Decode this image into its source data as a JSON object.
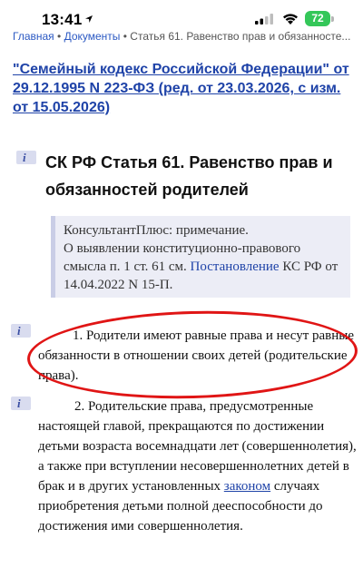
{
  "status_bar": {
    "time": "13:41",
    "battery": "72"
  },
  "breadcrumb": {
    "home": "Главная",
    "sep1": " • ",
    "documents": "Документы",
    "sep2": " • ",
    "current": "Статья 61. Равенство прав и обязанносте..."
  },
  "document": {
    "title": "\"Семейный кодекс Российской Федерации\" от 29.12.1995 N 223-ФЗ (ред. от 23.03.2026, с изм. от 15.05.2026)"
  },
  "info_marker_glyph": "i",
  "article": {
    "heading": "СК РФ Статья 61. Равенство прав и обязанностей родителей"
  },
  "note": {
    "line1": "КонсультантПлюс: примечание.",
    "text_before_link": "О выявлении конституционно-правового смысла п. 1 ст. 61 см. ",
    "link": "Постановление",
    "text_after_link": " КС РФ от 14.04.2022 N 15-П."
  },
  "paragraphs": {
    "p1": "1. Родители имеют равные права и несут равные обязанности в отношении своих детей (родительские права).",
    "p2_before_link": "2. Родительские права, предусмотренные настоящей главой, прекращаются по достижении детьми возраста восемнадцати лет (совершеннолетия), а также при вступлении несовершеннолетних детей в брак и в других установленных ",
    "p2_link": "законом",
    "p2_after_link": " случаях приобретения детьми полной дееспособности до достижения ими совершеннолетия."
  },
  "colors": {
    "link": "#1f43a8",
    "annotation": "#e01515",
    "battery": "#34c759"
  }
}
